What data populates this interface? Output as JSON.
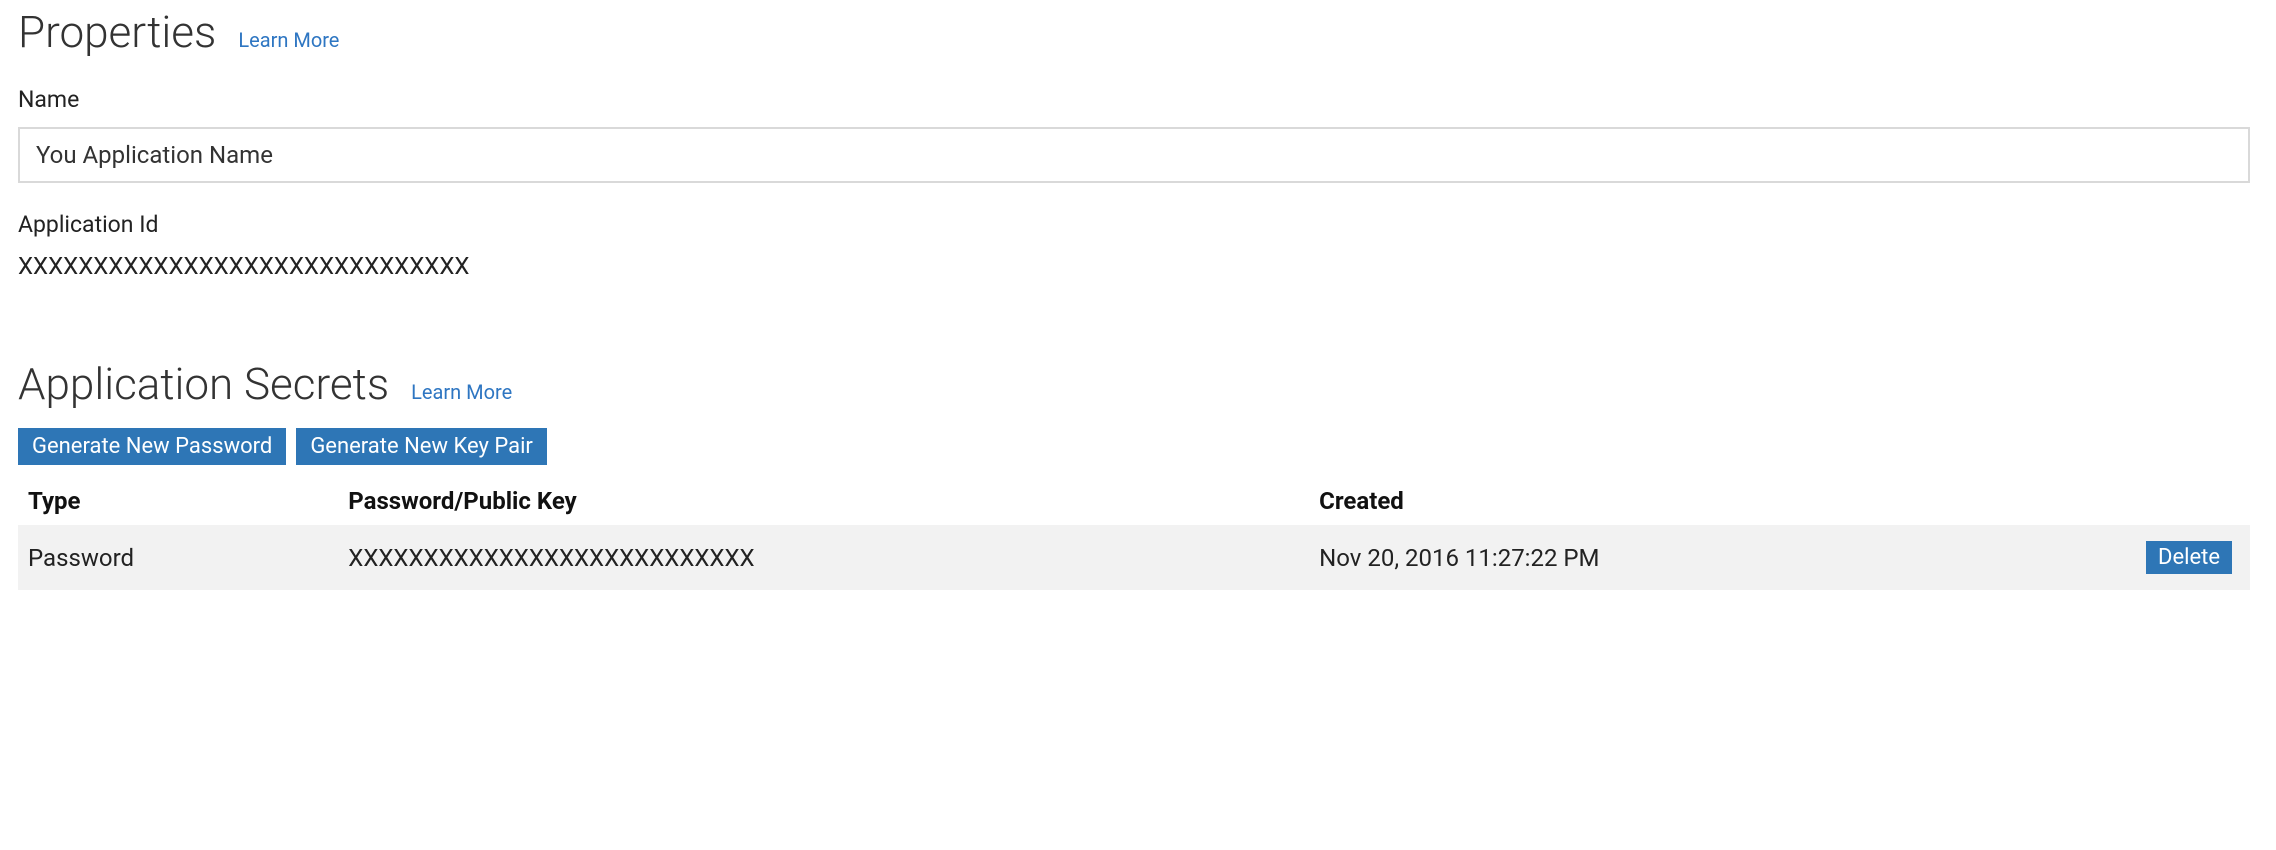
{
  "properties": {
    "heading": "Properties",
    "learn_more": "Learn More",
    "name_label": "Name",
    "name_value": "You Application Name",
    "app_id_label": "Application Id",
    "app_id_value": "XXXXXXXXXXXXXXXXXXXXXXXXXXXXXX"
  },
  "secrets": {
    "heading": "Application Secrets",
    "learn_more": "Learn More",
    "generate_password_btn": "Generate New Password",
    "generate_keypair_btn": "Generate New Key Pair",
    "columns": {
      "type": "Type",
      "key": "Password/Public Key",
      "created": "Created"
    },
    "rows": [
      {
        "type": "Password",
        "key": "XXXXXXXXXXXXXXXXXXXXXXXXXXX",
        "created": "Nov 20, 2016 11:27:22 PM",
        "delete_label": "Delete"
      }
    ]
  }
}
